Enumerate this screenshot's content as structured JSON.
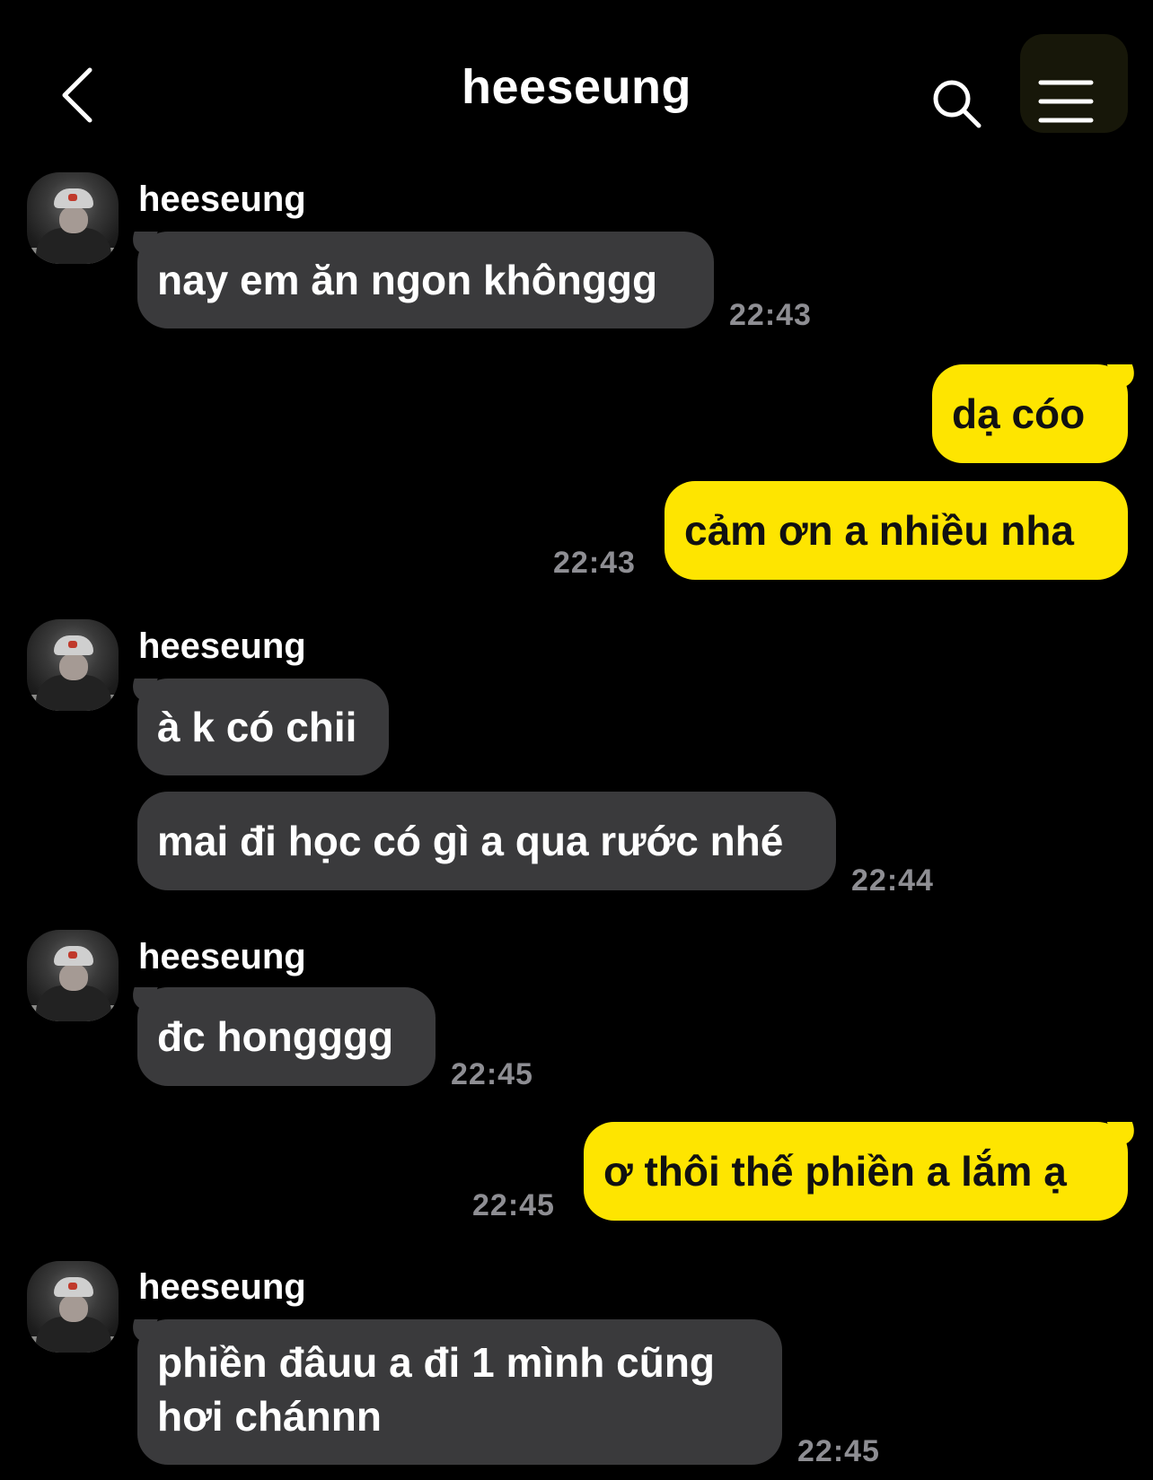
{
  "header": {
    "title": "heeseung",
    "back_icon": "chevron-left-icon",
    "search_icon": "search-icon",
    "menu_icon": "hamburger-menu-icon"
  },
  "colors": {
    "background": "#000000",
    "incoming_bubble": "#3a3a3c",
    "outgoing_bubble": "#fee500",
    "timestamp": "#8e8e93"
  },
  "messages": [
    {
      "sender": "heeseung",
      "direction": "in",
      "text": "nay em ăn ngon khônggg",
      "time": "22:43"
    },
    {
      "direction": "out",
      "text": "dạ cóo"
    },
    {
      "direction": "out",
      "text": "cảm ơn a nhiều nha",
      "time": "22:43"
    },
    {
      "sender": "heeseung",
      "direction": "in",
      "text": "à k có chii"
    },
    {
      "direction": "in",
      "text": "mai đi học có gì a qua rước nhé",
      "time": "22:44"
    },
    {
      "sender": "heeseung",
      "direction": "in",
      "text": "đc hongggg",
      "time": "22:45"
    },
    {
      "direction": "out",
      "text": "ơ thôi thế phiền a lắm ạ",
      "time": "22:45"
    },
    {
      "sender": "heeseung",
      "direction": "in",
      "text_line1": "phiền đâuu a đi 1 mình cũng",
      "text_line2": "hơi chánnn",
      "time": "22:45"
    }
  ]
}
